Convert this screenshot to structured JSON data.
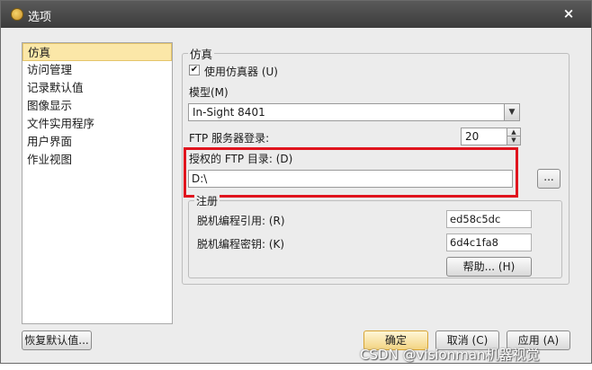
{
  "window": {
    "title": "选项",
    "close_glyph": "×"
  },
  "sidebar": {
    "items": [
      {
        "label": "仿真",
        "selected": true
      },
      {
        "label": "访问管理"
      },
      {
        "label": "记录默认值"
      },
      {
        "label": "图像显示"
      },
      {
        "label": "文件实用程序"
      },
      {
        "label": "用户界面"
      },
      {
        "label": "作业视图"
      }
    ]
  },
  "emulation": {
    "group_title": "仿真",
    "use_emulator_label": "使用仿真器 (U)",
    "use_emulator_checked": true,
    "model_label": "模型(M)",
    "model_value": "In-Sight 8401",
    "ftp_login_label": "FTP 服务器登录:",
    "ftp_login_value": "20",
    "authorized_dir_label": "授权的 FTP 目录: (D)",
    "authorized_dir_value": "D:\\",
    "browse_label": "..."
  },
  "registration": {
    "title": "注册",
    "offline_ref_label": "脱机编程引用: (R)",
    "offline_ref_value": "ed58c5dc",
    "offline_key_label": "脱机编程密钥: (K)",
    "offline_key_value": "6d4c1fa8",
    "help_label": "帮助... (H)"
  },
  "footer": {
    "restore_defaults": "恢复默认值...",
    "ok": "确定",
    "cancel": "取消 (C)",
    "apply": "应用 (A)"
  },
  "watermark": "CSDN @visionman机器视觉",
  "colors": {
    "highlight": "#e0141e",
    "selection": "#fbe7a8",
    "titlebar": "#4a4a4a"
  },
  "icons": {
    "title": "app-logo-icon",
    "close": "close-icon",
    "check": "checkmark-icon",
    "dropdown": "chevron-down-icon"
  }
}
